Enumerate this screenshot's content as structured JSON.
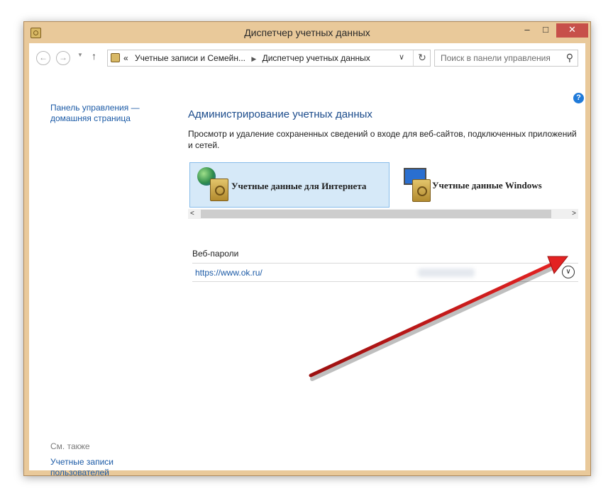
{
  "window": {
    "title": "Диспетчер учетных данных",
    "controls": {
      "minimize": "–",
      "maximize": "□",
      "close": "✕"
    }
  },
  "navbar": {
    "back_icon": "←",
    "forward_icon": "→",
    "up_icon": "↑",
    "breadcrumb_prefix": "«",
    "breadcrumb": [
      "Учетные записи и Семейн...",
      "Диспетчер учетных данных"
    ],
    "search_placeholder": "Поиск в панели управления"
  },
  "sidebar": {
    "home_link": "Панель управления — домашняя страница",
    "see_also": "См. также",
    "user_accounts_link": "Учетные записи пользователей"
  },
  "main": {
    "heading": "Администрирование учетных данных",
    "description": "Просмотр и удаление сохраненных сведений о входе для веб-сайтов, подключенных приложений и сетей.",
    "cards": [
      {
        "label": "Учетные данные для Интернета",
        "selected": true,
        "icon": "globe-safe-icon"
      },
      {
        "label": "Учетные данные Windows",
        "selected": false,
        "icon": "monitor-safe-icon"
      }
    ],
    "section_title": "Веб-пароли",
    "entries": [
      {
        "url": "https://www.ok.ru/"
      }
    ]
  },
  "colors": {
    "frame": "#e9c99a",
    "close_button": "#c7504a",
    "link": "#1b5aa6",
    "heading": "#1c4c8c",
    "selected_card": "#d6e9f8",
    "annotation_arrow": "#d41515"
  }
}
